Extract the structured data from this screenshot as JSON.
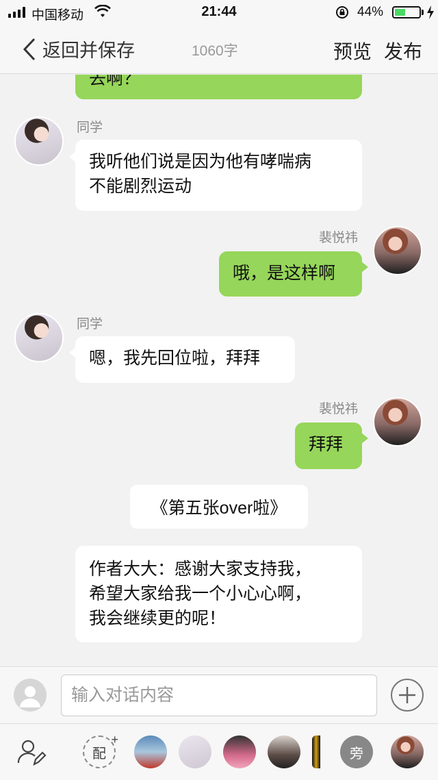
{
  "status_bar": {
    "carrier": "中国移动",
    "time": "21:44",
    "battery_percent": "44%",
    "battery_level": 0.44,
    "battery_color": "#4cd964"
  },
  "nav": {
    "back_label": "返回并保存",
    "word_count": "1060字",
    "preview_label": "预览",
    "publish_label": "发布"
  },
  "chat": {
    "colors": {
      "self_bubble": "#96d65a",
      "other_bubble": "#ffffff",
      "background": "#f2f2f2"
    },
    "partial_top_text": "去啊？",
    "messages": [
      {
        "sender": "同学",
        "side": "left",
        "lines": [
          "我听他们说是因为他有哮喘病",
          "不能剧烈运动"
        ]
      },
      {
        "sender": "裴悦祎",
        "side": "right",
        "lines": [
          "哦，是这样啊"
        ]
      },
      {
        "sender": "同学",
        "side": "left",
        "lines": [
          "嗯，我先回位啦，拜拜"
        ]
      },
      {
        "sender": "裴悦祎",
        "side": "right",
        "lines": [
          "拜拜"
        ]
      }
    ],
    "center_note": "《第五张over啦》",
    "narration_lines": [
      "作者大大：感谢大家支持我，",
      "希望大家给我一个小心心啊，",
      "我会继续更的呢！"
    ]
  },
  "input_bar": {
    "placeholder": "输入对话内容",
    "icons": [
      "user-icon",
      "plus-icon"
    ]
  },
  "bottom_bar": {
    "add_role_label": "配",
    "add_role_sup": "+",
    "narrator_label": "旁",
    "icons": [
      "edit-user-icon"
    ]
  }
}
